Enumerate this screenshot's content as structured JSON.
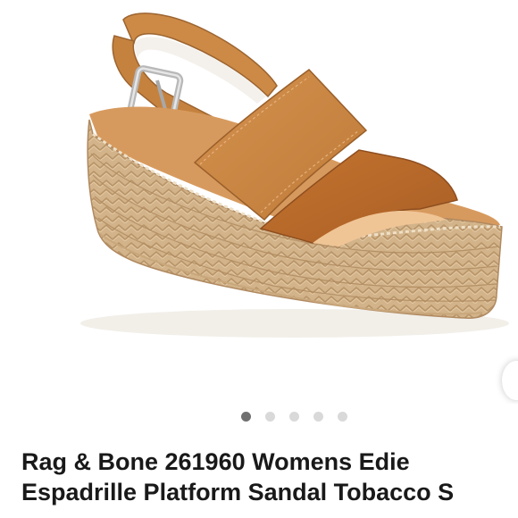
{
  "listing": {
    "title_line_1": "Rag & Bone 261960 Womens Edie",
    "title_line_2": "Espadrille Platform Sandal Tobacco S"
  },
  "carousel": {
    "image_count": 5,
    "active_index": 0
  },
  "icons": {
    "next": "next-image-edge"
  },
  "colors": {
    "title": "#191919",
    "dot_active": "#707070",
    "dot_inactive": "#d9d9d9",
    "leather": "#c98543",
    "suede": "#bd6a2c",
    "jute": "#d3b58c"
  }
}
